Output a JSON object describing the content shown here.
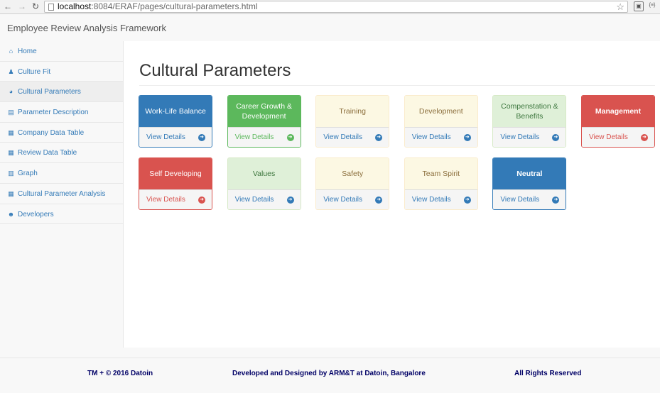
{
  "browser": {
    "url_host": "localhost",
    "url_path": ":8084/ERAF/pages/cultural-parameters.html",
    "ext_label": "{≡}"
  },
  "navbar": {
    "brand": "Employee Review Analysis Framework"
  },
  "sidebar": {
    "items": [
      {
        "label": "Home",
        "icon": "home-icon",
        "glyph": "⌂"
      },
      {
        "label": "Culture Fit",
        "icon": "users-icon",
        "glyph": "♟"
      },
      {
        "label": "Cultural Parameters",
        "icon": "gauge-icon",
        "glyph": "◕"
      },
      {
        "label": "Parameter Description",
        "icon": "file-icon",
        "glyph": "▤"
      },
      {
        "label": "Company Data Table",
        "icon": "table-icon",
        "glyph": "▦"
      },
      {
        "label": "Review Data Table",
        "icon": "table-icon",
        "glyph": "▦"
      },
      {
        "label": "Graph",
        "icon": "bar-chart-icon",
        "glyph": "▥"
      },
      {
        "label": "Cultural Parameter Analysis",
        "icon": "table-icon",
        "glyph": "▦"
      },
      {
        "label": "Developers",
        "icon": "group-icon",
        "glyph": "☻"
      }
    ]
  },
  "main": {
    "title": "Cultural Parameters",
    "view_details_label": "View Details",
    "panels": [
      {
        "name": "Work-Life Balance",
        "style": "primary"
      },
      {
        "name": "Career Growth & Development",
        "style": "green"
      },
      {
        "name": "Training",
        "style": "yellow"
      },
      {
        "name": "Development",
        "style": "yellow"
      },
      {
        "name": "Compenstation & Benefits",
        "style": "lightgreen"
      },
      {
        "name": "Management",
        "style": "red"
      },
      {
        "name": "Self Developing",
        "style": "red"
      },
      {
        "name": "Values",
        "style": "lightgreen"
      },
      {
        "name": "Safety",
        "style": "yellow"
      },
      {
        "name": "Team Spirit",
        "style": "yellow"
      },
      {
        "name": "Neutral",
        "style": "primary"
      }
    ]
  },
  "footer": {
    "left": "TM + © 2016 Datoin",
    "center": "Developed and Designed by ARM&T at Datoin, Bangalore",
    "right": "All Rights Reserved"
  },
  "colors": {
    "primary": "#337ab7",
    "success": "#5cb85c",
    "danger": "#d9534f",
    "warning_bg": "#fcf8e3",
    "success_bg": "#dff0d8"
  }
}
